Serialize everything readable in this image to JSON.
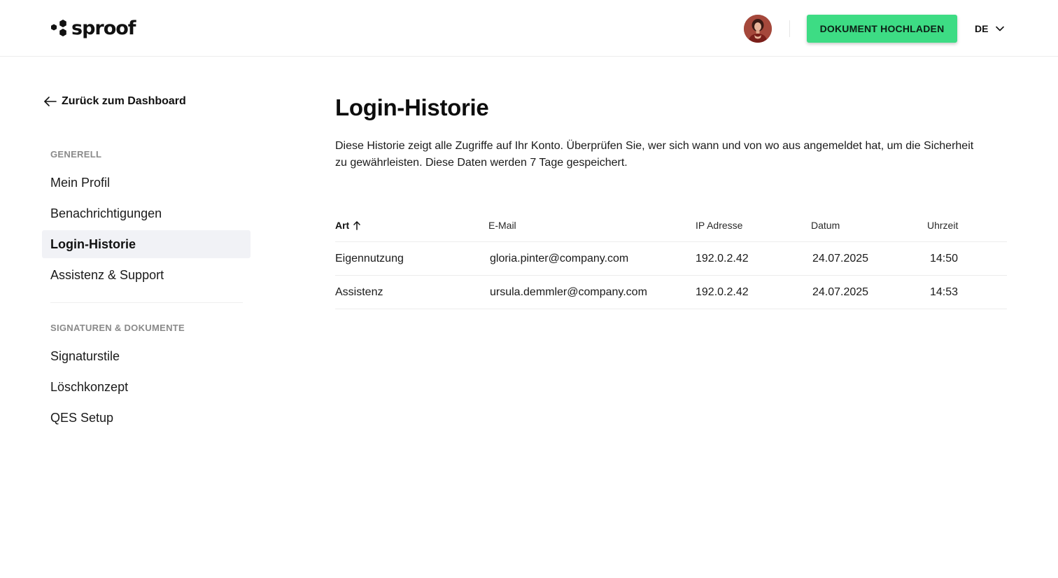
{
  "header": {
    "logo_text": "sproof",
    "upload_button": "DOKUMENT HOCHLADEN",
    "language": "DE",
    "brand_color": "#3ddc84"
  },
  "sidebar": {
    "back_link": "Zurück zum Dashboard",
    "sections": [
      {
        "title": "GENERELL",
        "items": [
          {
            "label": "Mein Profil",
            "active": false
          },
          {
            "label": "Benachrichtigungen",
            "active": false
          },
          {
            "label": "Login-Historie",
            "active": true
          },
          {
            "label": "Assistenz & Support",
            "active": false
          }
        ]
      },
      {
        "title": "SIGNATUREN & DOKUMENTE",
        "items": [
          {
            "label": "Signaturstile",
            "active": false
          },
          {
            "label": "Löschkonzept",
            "active": false
          },
          {
            "label": "QES Setup",
            "active": false
          }
        ]
      }
    ]
  },
  "main": {
    "title": "Login-Historie",
    "description": "Diese Historie zeigt alle Zugriffe auf Ihr Konto. Überprüfen Sie, wer sich wann und von wo aus angemeldet hat, um die Sicherheit zu gewährleisten. Diese Daten werden 7 Tage gespeichert.",
    "table": {
      "columns": [
        "Art",
        "E-Mail",
        "IP Adresse",
        "Datum",
        "Uhrzeit"
      ],
      "rows": [
        [
          "Eigennutzung",
          "gloria.pinter@company.com",
          "192.0.2.42",
          "24.07.2025",
          "14:50"
        ],
        [
          "Assistenz",
          "ursula.demmler@company.com",
          "192.0.2.42",
          "24.07.2025",
          "14:53"
        ]
      ]
    }
  }
}
